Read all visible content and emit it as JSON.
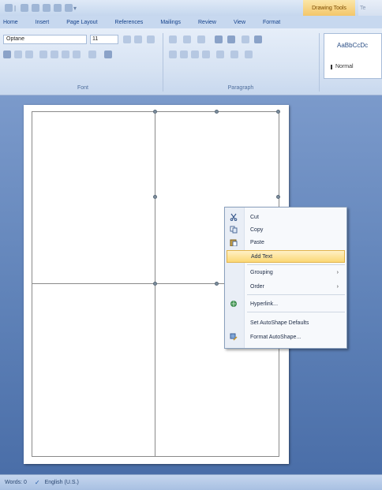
{
  "ribbon": {
    "contextual_tab": "Drawing Tools",
    "contextual_tab_overflow": "Te",
    "tabs": [
      "Home",
      "Insert",
      "Page Layout",
      "References",
      "Mailings",
      "Review",
      "View",
      "Format"
    ],
    "font_name": "Optane",
    "font_size": "11",
    "groups": [
      "Font",
      "Paragraph"
    ],
    "styles_sample": "AaBbCcDc",
    "styles_name": "Normal"
  },
  "context_menu": {
    "items": [
      {
        "label": "Cut",
        "icon": "scissors-icon"
      },
      {
        "label": "Copy",
        "icon": "copy-icon"
      },
      {
        "label": "Paste",
        "icon": "paste-icon"
      },
      {
        "label": "Add Text",
        "icon": ""
      },
      {
        "label": "Grouping",
        "icon": "",
        "submenu": true
      },
      {
        "label": "Order",
        "icon": "",
        "submenu": true
      },
      {
        "label": "Hyperlink...",
        "icon": "hyperlink-icon"
      },
      {
        "label": "Set AutoShape Defaults",
        "icon": ""
      },
      {
        "label": "Format AutoShape...",
        "icon": "format-shape-icon"
      }
    ],
    "highlighted": "Add Text"
  },
  "status_bar": {
    "words": "Words: 0",
    "language": "English (U.S.)"
  },
  "colors": {
    "accent_tab": "#f3c66a",
    "workspace": "#5f82b8",
    "menu_highlight": "#fbd875"
  }
}
